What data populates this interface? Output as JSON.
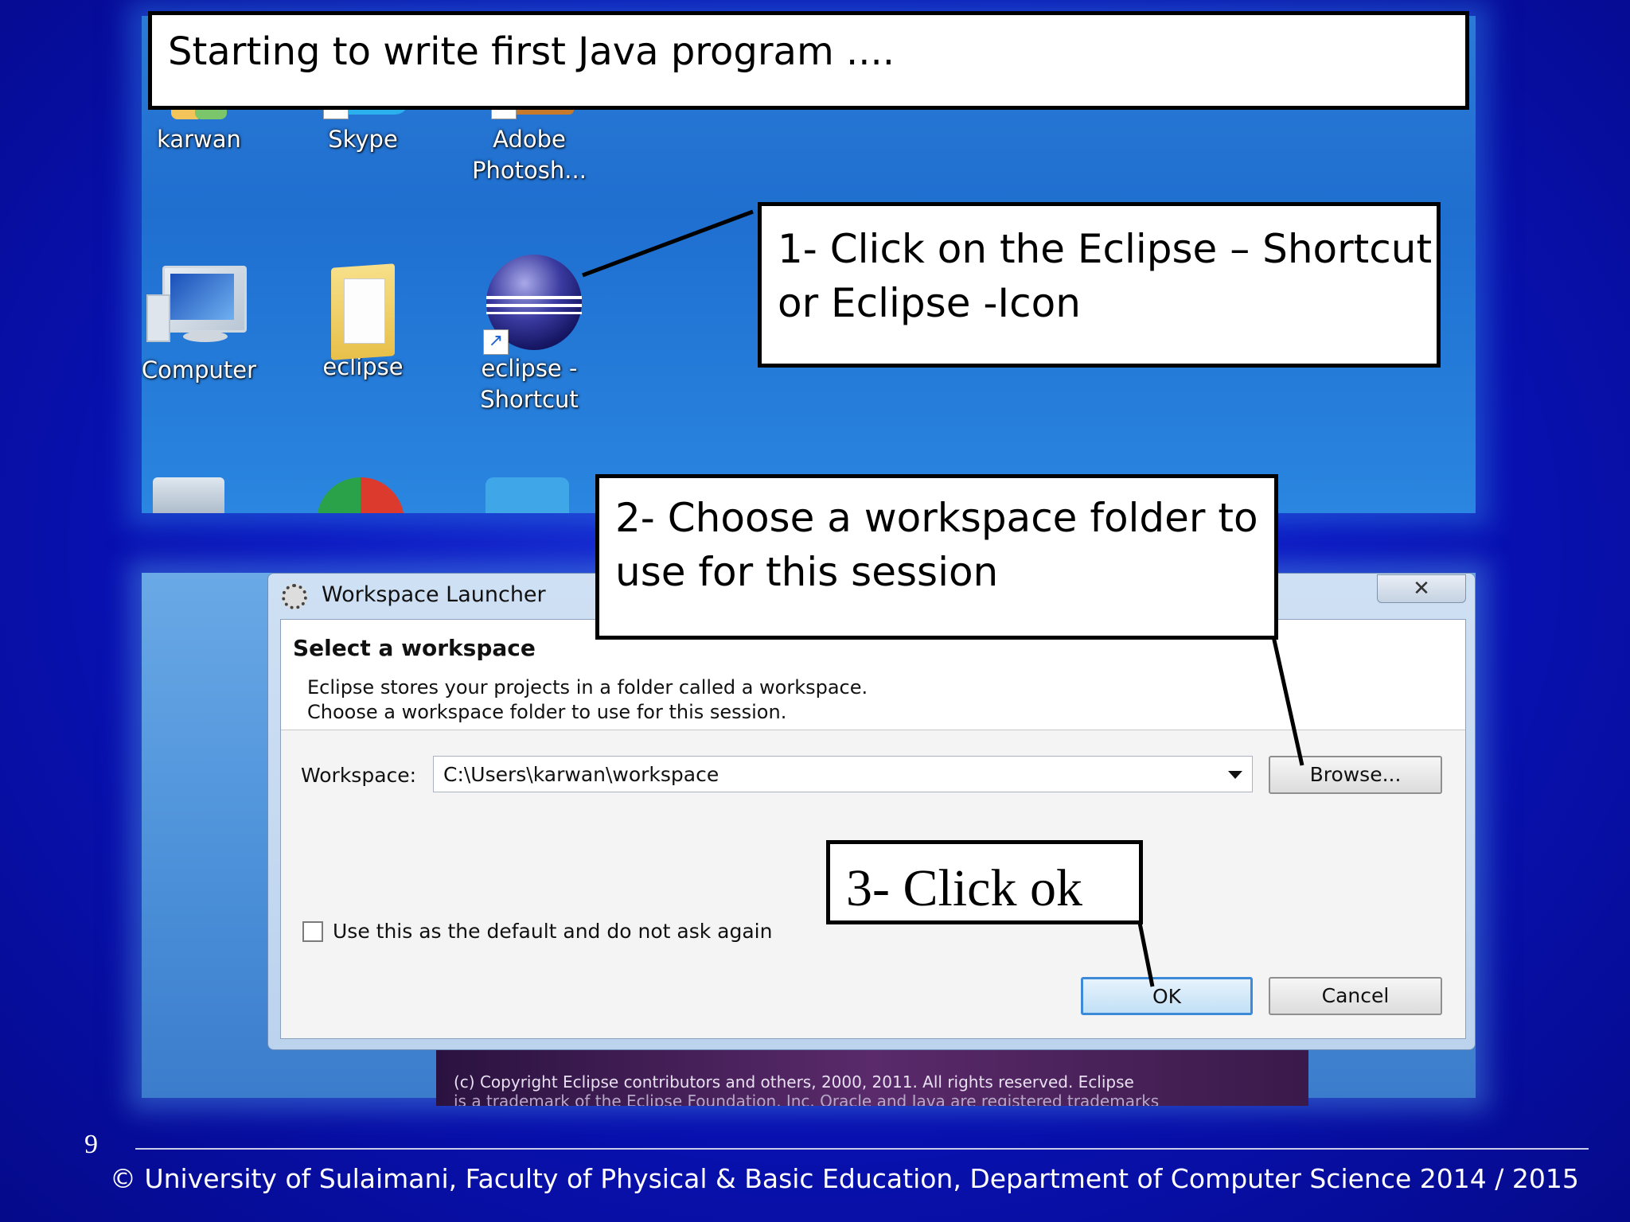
{
  "slide": {
    "title": "Starting to write first Java program ....",
    "page_number": "9",
    "footer": "© University of Sulaimani, Faculty of Physical & Basic Education, Department of Computer Science  2014 / 2015"
  },
  "desktop": {
    "icons": [
      {
        "label": "karwan"
      },
      {
        "label": "Skype"
      },
      {
        "label_line1": "Adobe",
        "label_line2": "Photosh..."
      },
      {
        "label": "Computer"
      },
      {
        "label": "eclipse"
      },
      {
        "label_line1": "eclipse -",
        "label_line2": "Shortcut"
      }
    ]
  },
  "callouts": {
    "step1_line1": "1- Click on the Eclipse – Shortcut",
    "step1_line2": "or Eclipse -Icon",
    "step2_line1": "2- Choose a workspace folder to",
    "step2_line2": "use for this session",
    "step3": "3- Click ok"
  },
  "dialog": {
    "title": "Workspace Launcher",
    "close_symbol": "✕",
    "heading": "Select a workspace",
    "description_line1": "Eclipse stores your projects in a folder called a workspace.",
    "description_line2": "Choose a workspace folder to use for this session.",
    "workspace_label": "Workspace:",
    "workspace_value": "C:\\Users\\karwan\\workspace",
    "browse_label": "Browse...",
    "default_checkbox_label": "Use this as the default and do not ask again",
    "ok_label": "OK",
    "cancel_label": "Cancel",
    "splash_line1": "(c) Copyright Eclipse contributors and others, 2000, 2011.  All rights reserved. Eclipse",
    "splash_line2": "is a trademark of the Eclipse Foundation, Inc. Oracle and Java are registered trademarks"
  },
  "colors": {
    "background": "#0a14c0",
    "desktop": "#1f6fd0",
    "ok_button_border": "#3c8ad8"
  }
}
